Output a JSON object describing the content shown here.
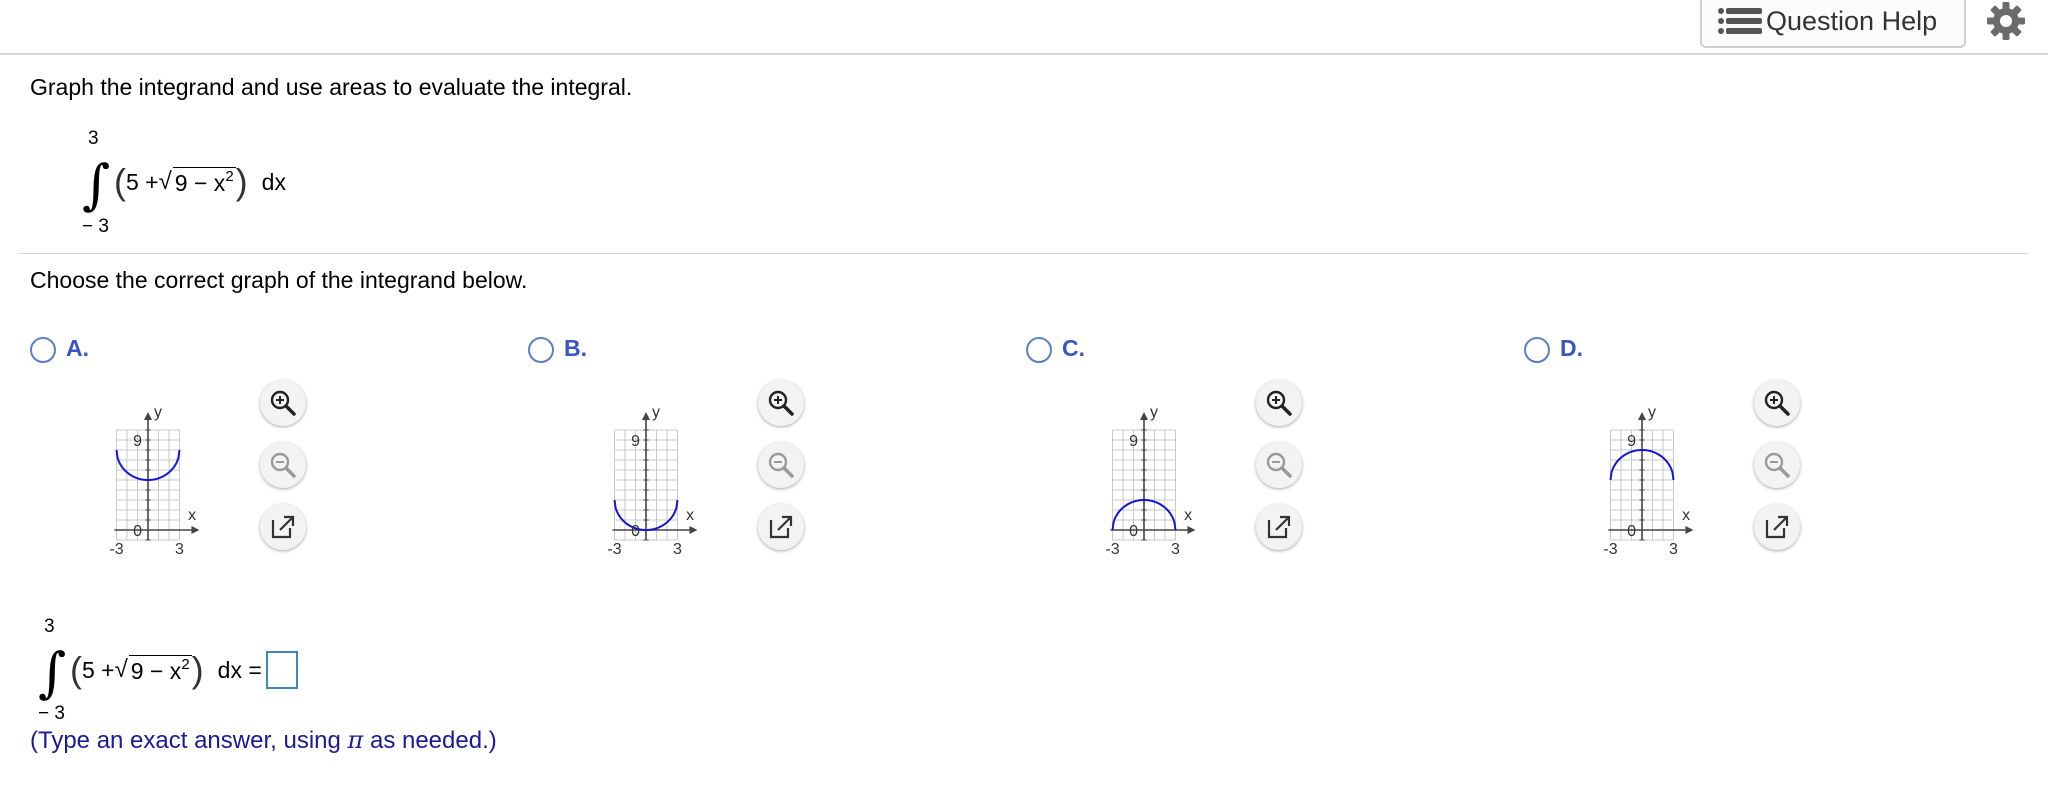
{
  "header": {
    "question_help": "Question Help",
    "icons": [
      "list-icon",
      "gear-icon"
    ]
  },
  "prompt": "Graph the integrand and use areas to evaluate the integral.",
  "integral": {
    "upper": "3",
    "lower": "− 3",
    "sign": "∫",
    "expr_const": "5 +",
    "radicand": "9 − x",
    "exp": "2",
    "dx": "dx"
  },
  "choose": "Choose the correct graph of the integrand below.",
  "options": [
    {
      "letter": "A.",
      "graph": {
        "y_label": "y",
        "x_label": "x",
        "y_tick": "9",
        "y_zero": "0",
        "x_min": "-3",
        "x_max": "3",
        "curve": "lower semicircle, bottom at y=5"
      }
    },
    {
      "letter": "B.",
      "graph": {
        "y_label": "y",
        "x_label": "x",
        "y_tick": "9",
        "y_zero": "0",
        "x_min": "-3",
        "x_max": "3",
        "curve": "lower semicircle, bottom at y=0"
      }
    },
    {
      "letter": "C.",
      "graph": {
        "y_label": "y",
        "x_label": "x",
        "y_tick": "9",
        "y_zero": "0",
        "x_min": "-3",
        "x_max": "3",
        "curve": "upper semicircle, top at y=3"
      }
    },
    {
      "letter": "D.",
      "graph": {
        "y_label": "y",
        "x_label": "x",
        "y_tick": "9",
        "y_zero": "0",
        "x_min": "-3",
        "x_max": "3",
        "curve": "upper semicircle, top at y=8"
      }
    }
  ],
  "tools": [
    "zoom-in-icon",
    "zoom-out-icon",
    "open-new-window-icon"
  ],
  "answer": {
    "equals": "dx =",
    "value": ""
  },
  "hint": {
    "before": "(Type an exact answer, using ",
    "pi": "π",
    "after": " as needed.)"
  },
  "colors": {
    "curve": "#1414d9",
    "radio": "#5b7fc7",
    "letter": "#3955c2",
    "hint": "#1a1a99",
    "answer_border": "#3d87c4"
  }
}
